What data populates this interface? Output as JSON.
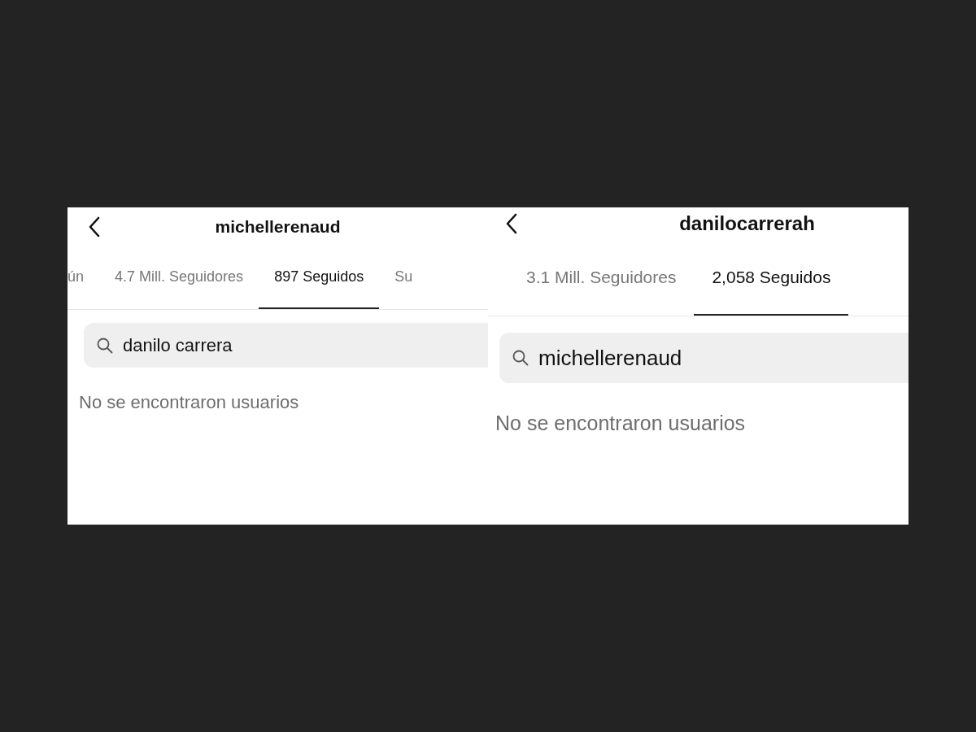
{
  "panels": [
    {
      "title": "michellerenaud",
      "tabs": [
        {
          "label": "ún",
          "selected": false
        },
        {
          "label": "4.7 Mill. Seguidores",
          "selected": false
        },
        {
          "label": "897 Seguidos",
          "selected": true
        },
        {
          "label": "Su",
          "selected": false
        }
      ],
      "search": {
        "value": "danilo carrera"
      },
      "message": "No se encontraron usuarios"
    },
    {
      "title": "danilocarrerah",
      "tabs": [
        {
          "label": "3.1 Mill. Seguidores",
          "selected": false
        },
        {
          "label": "2,058 Seguidos",
          "selected": true
        }
      ],
      "search": {
        "value": "michellerenaud"
      },
      "message": "No se encontraron usuarios"
    }
  ]
}
